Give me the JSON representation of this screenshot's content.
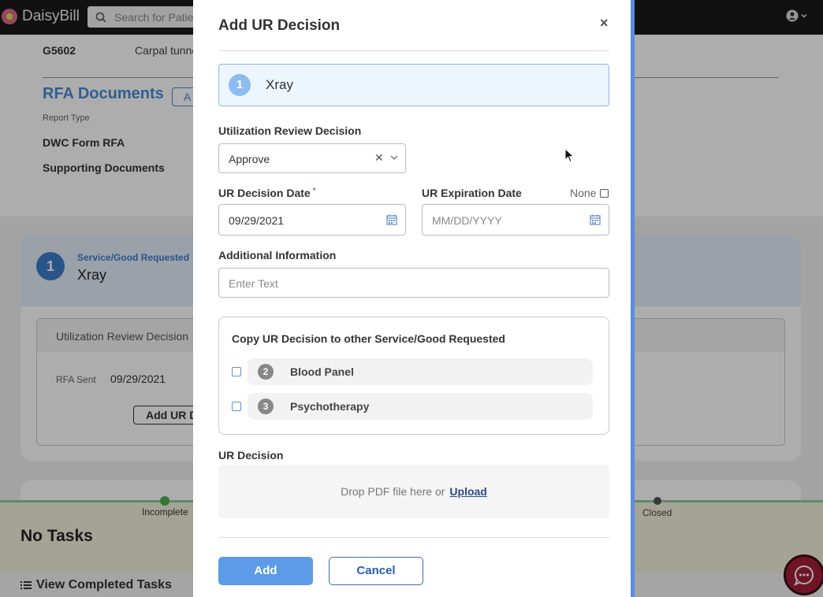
{
  "app": {
    "name": "DaisyBill"
  },
  "header": {
    "search_placeholder": "Search for Patien"
  },
  "background": {
    "code": "G5602",
    "description": "Carpal tunne",
    "rfa_documents_title": "RFA Documents",
    "rfa_add_label": "A",
    "report_type_label": "Report Type",
    "documents": [
      "DWC Form RFA",
      "Supporting Documents"
    ],
    "service": {
      "number": "1",
      "label": "Service/Good Requested",
      "name": "Xray"
    },
    "urd_section_title": "Utilization Review Decision",
    "rfa_sent_label": "RFA Sent",
    "rfa_sent_date": "09/29/2021",
    "add_ur_button": "Add UR D",
    "progress": {
      "incomplete": "Incomplete",
      "closed": "Closed"
    },
    "tasks": {
      "no_tasks": "No Tasks",
      "view_completed": "View Completed Tasks"
    }
  },
  "modal": {
    "title": "Add UR Decision",
    "service": {
      "number": "1",
      "name": "Xray"
    },
    "ur_decision_label": "Utilization Review Decision",
    "ur_decision_value": "Approve",
    "decision_date_label": "UR Decision Date",
    "decision_date_required": "*",
    "decision_date_value": "09/29/2021",
    "expiration_label": "UR Expiration Date",
    "none_label": "None",
    "expiration_placeholder": "MM/DD/YYYY",
    "additional_info_label": "Additional Information",
    "additional_info_placeholder": "Enter Text",
    "copy_section_title": "Copy UR Decision to other Service/Good Requested",
    "copy_items": [
      {
        "number": "2",
        "name": "Blood Panel"
      },
      {
        "number": "3",
        "name": "Psychotherapy"
      }
    ],
    "ur_decision_file_label": "UR Decision",
    "drop_text": "Drop PDF file here or",
    "upload_link": "Upload",
    "add_button": "Add",
    "cancel_button": "Cancel"
  },
  "colors": {
    "accent": "#5b9be8",
    "brand_link": "#4a8ad6",
    "chat": "#a41e3a"
  }
}
